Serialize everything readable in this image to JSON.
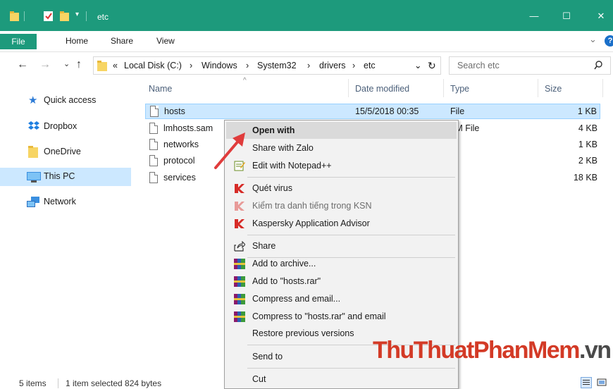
{
  "window": {
    "title": "etc",
    "minimize": "—",
    "maximize": "☐",
    "close": "✕"
  },
  "ribbon": {
    "tabs": [
      "File",
      "Home",
      "Share",
      "View"
    ],
    "expand": "⌄",
    "help": "?"
  },
  "address": {
    "back": "←",
    "forward": "→",
    "recent": "⌄",
    "up": "↑",
    "prefix": "«",
    "path": [
      "Local Disk (C:)",
      "Windows",
      "System32",
      "drivers",
      "etc"
    ],
    "separator": "›",
    "dropdown": "⌄",
    "refresh": "↻",
    "search_placeholder": "Search etc",
    "search_icon": "⌕"
  },
  "nav": {
    "items": [
      {
        "label": "Quick access",
        "icon": "star-icon"
      },
      {
        "label": "Dropbox",
        "icon": "dropbox-icon"
      },
      {
        "label": "OneDrive",
        "icon": "folder-icon"
      },
      {
        "label": "This PC",
        "icon": "computer-icon"
      },
      {
        "label": "Network",
        "icon": "network-icon"
      }
    ]
  },
  "filelist": {
    "columns": [
      "Name",
      "Date modified",
      "Type",
      "Size"
    ],
    "sort_indicator": "^",
    "rows": [
      {
        "name": "hosts",
        "date": "15/5/2018 00:35",
        "type": "File",
        "size": "1 KB"
      },
      {
        "name": "lmhosts.sam",
        "date": "",
        "type": "AM File",
        "size": "4 KB"
      },
      {
        "name": "networks",
        "date": "",
        "type": "le",
        "size": "1 KB"
      },
      {
        "name": "protocol",
        "date": "",
        "type": "le",
        "size": "2 KB"
      },
      {
        "name": "services",
        "date": "",
        "type": "le",
        "size": "18 KB"
      }
    ]
  },
  "context_menu": {
    "items": [
      {
        "label": "Open with",
        "icon": "none"
      },
      {
        "label": "Share with Zalo",
        "icon": "zalo-icon"
      },
      {
        "label": "Edit with Notepad++",
        "icon": "notepad-icon"
      },
      {
        "label": "Quét virus",
        "icon": "kaspersky-icon"
      },
      {
        "label": "Kiểm tra danh tiếng trong KSN",
        "icon": "kaspersky-icon"
      },
      {
        "label": "Kaspersky Application Advisor",
        "icon": "kaspersky-icon"
      },
      {
        "label": "Share",
        "icon": "share-icon"
      },
      {
        "label": "Add to archive...",
        "icon": "winrar-icon"
      },
      {
        "label": "Add to \"hosts.rar\"",
        "icon": "winrar-icon"
      },
      {
        "label": "Compress and email...",
        "icon": "winrar-icon"
      },
      {
        "label": "Compress to \"hosts.rar\" and email",
        "icon": "winrar-icon"
      },
      {
        "label": "Restore previous versions",
        "icon": "none"
      },
      {
        "label": "Send to",
        "icon": "none",
        "submenu": "›"
      },
      {
        "label": "Cut",
        "icon": "none"
      }
    ]
  },
  "status": {
    "items": "5 items",
    "selected": "1 item selected  824 bytes"
  },
  "watermark": {
    "part1": "ThuThuat",
    "part2": "PhanMem",
    "part3": ".vn"
  },
  "colors": {
    "titlebar": "#1d9a7c",
    "selection": "#cce8ff",
    "arrow": "#e03c3c"
  }
}
